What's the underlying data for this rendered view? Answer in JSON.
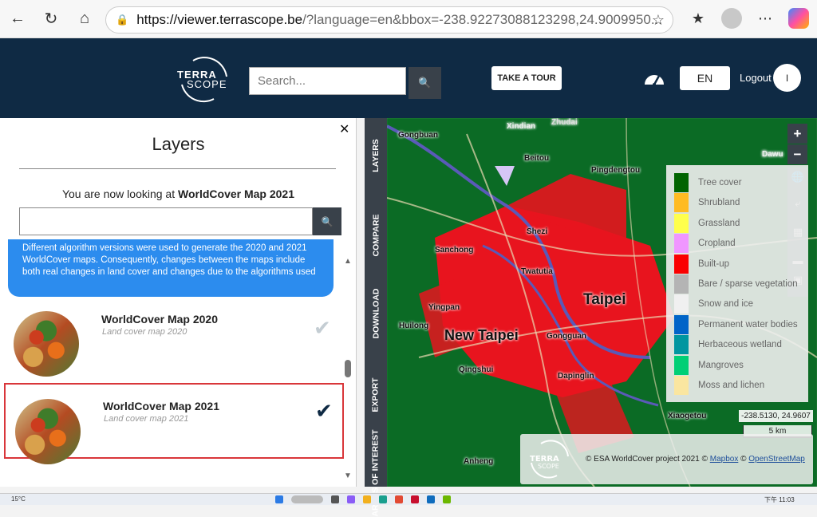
{
  "browser": {
    "url_host": "https://viewer.terrascope.be",
    "url_rest": "/?language=en&bbox=-238.92273088123298,24.9009950..."
  },
  "header": {
    "logo_line1": "TERRA",
    "logo_line2": "SCOPE",
    "search_placeholder": "Search...",
    "tour_label": "TAKE A TOUR",
    "lang_label": "EN",
    "logout_label": "Logout",
    "avatar_initial": "I"
  },
  "panel": {
    "title": "Layers",
    "looking_prefix": "You are now looking at ",
    "looking_layer": "WorldCover Map 2021",
    "notice_line1": "Different algorithm versions were used to generate the 2020 and 2021",
    "notice_line2": "WorldCover maps. Consequently, changes between the maps include",
    "notice_line3": "both real changes in land cover and changes due to the algorithms used",
    "layers": [
      {
        "name": "WorldCover Map 2020",
        "subtitle": "Land cover map 2020",
        "selected": false
      },
      {
        "name": "WorldCover Map 2021",
        "subtitle": "Land cover map 2021",
        "selected": true
      }
    ]
  },
  "tabs": [
    "LAYERS",
    "COMPARE",
    "DOWNLOAD",
    "EXPORT",
    "AREAS OF INTEREST"
  ],
  "legend": [
    {
      "label": "Tree cover",
      "color": "#006400"
    },
    {
      "label": "Shrubland",
      "color": "#ffbb22"
    },
    {
      "label": "Grassland",
      "color": "#ffff4c"
    },
    {
      "label": "Cropland",
      "color": "#f096ff"
    },
    {
      "label": "Built-up",
      "color": "#fa0000"
    },
    {
      "label": "Bare / sparse vegetation",
      "color": "#b4b4b4"
    },
    {
      "label": "Snow and ice",
      "color": "#f0f0f0"
    },
    {
      "label": "Permanent water bodies",
      "color": "#0064c8"
    },
    {
      "label": "Herbaceous wetland",
      "color": "#0096a0"
    },
    {
      "label": "Mangroves",
      "color": "#00cf75"
    },
    {
      "label": "Moss and lichen",
      "color": "#fae6a0"
    }
  ],
  "map": {
    "coords": "-238.5130, 24.9607",
    "scale": "5 km",
    "attribution_prefix": "© ESA WorldCover project 2021 ©",
    "attribution_mapbox": "Mapbox",
    "attribution_mid": "©",
    "attribution_osm": "OpenStreetMap",
    "places": [
      "Taipei",
      "New Taipei",
      "Xindian",
      "Sanchong",
      "Shezi",
      "Twatutia",
      "Yingpan",
      "Huilong",
      "Qingshui",
      "Gongguan",
      "Dapinglin",
      "Xiaogetou",
      "Anheng",
      "Pingdengtou",
      "Beitou",
      "Gongbuan",
      "Zhudai",
      "Dawu"
    ]
  },
  "taskbar": {
    "weather": "15°C",
    "clock": "下午 11:03"
  }
}
